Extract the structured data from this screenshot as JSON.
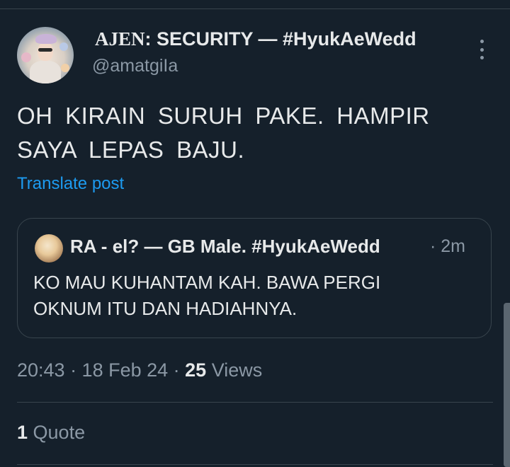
{
  "post": {
    "author": {
      "name_prefix": "AJEN",
      "name_rest": ": SECURITY — #HyukAeWedd",
      "handle": "@amatgiIa"
    },
    "text_lines": [
      "OH KIRAIN SURUH PAKE. HAMPIR",
      "SAYA LEPAS BAJU."
    ],
    "translate_label": "Translate post",
    "quoted": {
      "author_name": "RA - el? — GB Male. #HyukAeWedd",
      "time": "· 2m",
      "text_lines": [
        "KO MAU KUHANTAM KAH. BAWA PERGI",
        "OKNUM ITU DAN HADIAHNYA."
      ]
    },
    "timestamp": "20:43 · 18 Feb 24 · ",
    "views_count": "25",
    "views_label": " Views",
    "quotes_count": "1",
    "quotes_label": " Quote"
  },
  "icons": {
    "more": "more-vertical-icon"
  },
  "colors": {
    "background": "#15202b",
    "text": "#e7e9ea",
    "secondary": "#8b98a5",
    "link": "#1d9bf0",
    "border": "#38444d"
  }
}
